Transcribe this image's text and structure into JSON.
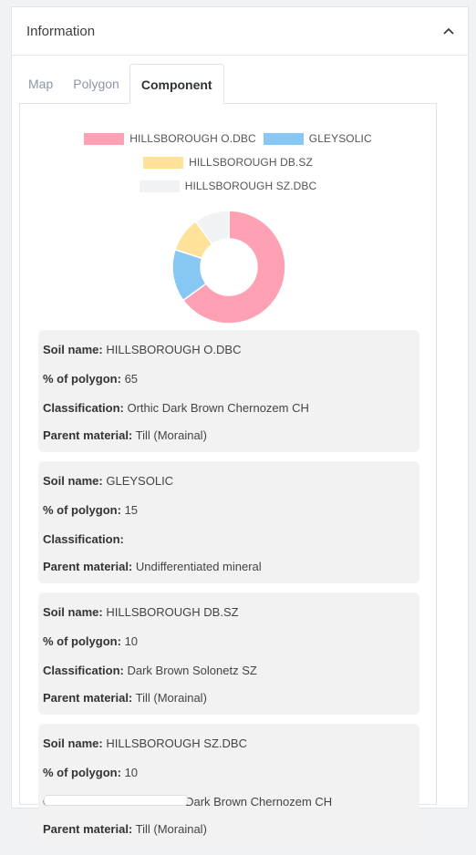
{
  "panel": {
    "title": "Information",
    "collapse_icon": "chevron-up-icon"
  },
  "tabs": [
    {
      "label": "Map",
      "active": false
    },
    {
      "label": "Polygon",
      "active": false
    },
    {
      "label": "Component",
      "active": true
    }
  ],
  "chart_data": {
    "type": "pie",
    "categories": [
      "HILLSBOROUGH O.DBC",
      "GLEYSOLIC",
      "HILLSBOROUGH DB.SZ",
      "HILLSBOROUGH SZ.DBC"
    ],
    "values": [
      65,
      15,
      10,
      10
    ],
    "colors": [
      "#ffa1b5",
      "#86c7f3",
      "#ffe29a",
      "#f1f2f4"
    ],
    "legend_position": "top",
    "donut": true
  },
  "soils": [
    {
      "soil_name_label": "Soil name:",
      "soil_name": "HILLSBOROUGH O.DBC",
      "pct_label": "% of polygon:",
      "pct": "65",
      "class_label": "Classification:",
      "classification": "Orthic Dark Brown Chernozem CH",
      "parent_label": "Parent material:",
      "parent": "Till (Morainal)"
    },
    {
      "soil_name_label": "Soil name:",
      "soil_name": "GLEYSOLIC",
      "pct_label": "% of polygon:",
      "pct": "15",
      "class_label": "Classification:",
      "classification": "",
      "parent_label": "Parent material:",
      "parent": "Undifferentiated mineral"
    },
    {
      "soil_name_label": "Soil name:",
      "soil_name": "HILLSBOROUGH DB.SZ",
      "pct_label": "% of polygon:",
      "pct": "10",
      "class_label": "Classification:",
      "classification": "Dark Brown Solonetz SZ",
      "parent_label": "Parent material:",
      "parent": "Till (Morainal)"
    },
    {
      "soil_name_label": "Soil name:",
      "soil_name": "HILLSBOROUGH SZ.DBC",
      "pct_label": "% of polygon:",
      "pct": "10",
      "class_label": "Classification:",
      "classification": "Solonetzic Dark Brown Chernozem CH",
      "parent_label": "Parent material:",
      "parent": "Till (Morainal)"
    }
  ]
}
